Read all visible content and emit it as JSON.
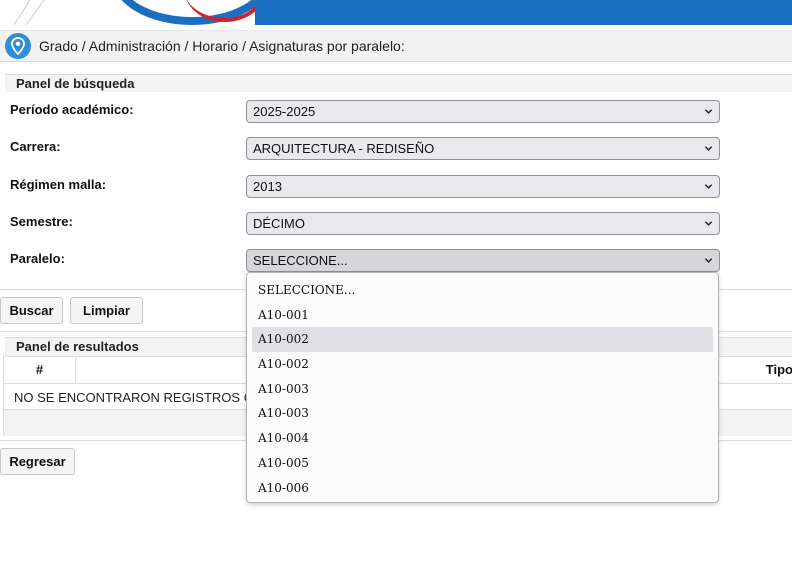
{
  "breadcrumb": {
    "path": "Grado / Administración / Horario / Asignaturas por paralelo:"
  },
  "search_panel": {
    "title": "Panel de búsqueda",
    "fields": [
      {
        "label": "Período académico:",
        "value": "2025-2025"
      },
      {
        "label": "Carrera:",
        "value": "ARQUITECTURA - REDISEÑO"
      },
      {
        "label": "Régimen malla:",
        "value": "2013"
      },
      {
        "label": "Semestre:",
        "value": "DÉCIMO"
      },
      {
        "label": "Paralelo:",
        "value": "SELECCIONE..."
      }
    ],
    "buttons": {
      "search": "Buscar",
      "clear": "Limpiar"
    }
  },
  "paralelo_dropdown": {
    "options": [
      "SELECCIONE...",
      "A10-001",
      "A10-002",
      "A10-002",
      "A10-003",
      "A10-003",
      "A10-004",
      "A10-005",
      "A10-006"
    ],
    "hover_index": 2
  },
  "results_panel": {
    "title": "Panel de resultados",
    "columns": [
      "#",
      "Tipo"
    ],
    "empty_message": "NO SE ENCONTRARON REGISTROS CON"
  },
  "footer": {
    "back_button": "Regresar"
  },
  "colors": {
    "banner_blue": "#1a6fc2",
    "banner_red": "#d0232a",
    "pin_blue": "#2e8fd6"
  },
  "icons": {
    "breadcrumb": "location-pin-icon",
    "select": "chevron-down-icon"
  }
}
